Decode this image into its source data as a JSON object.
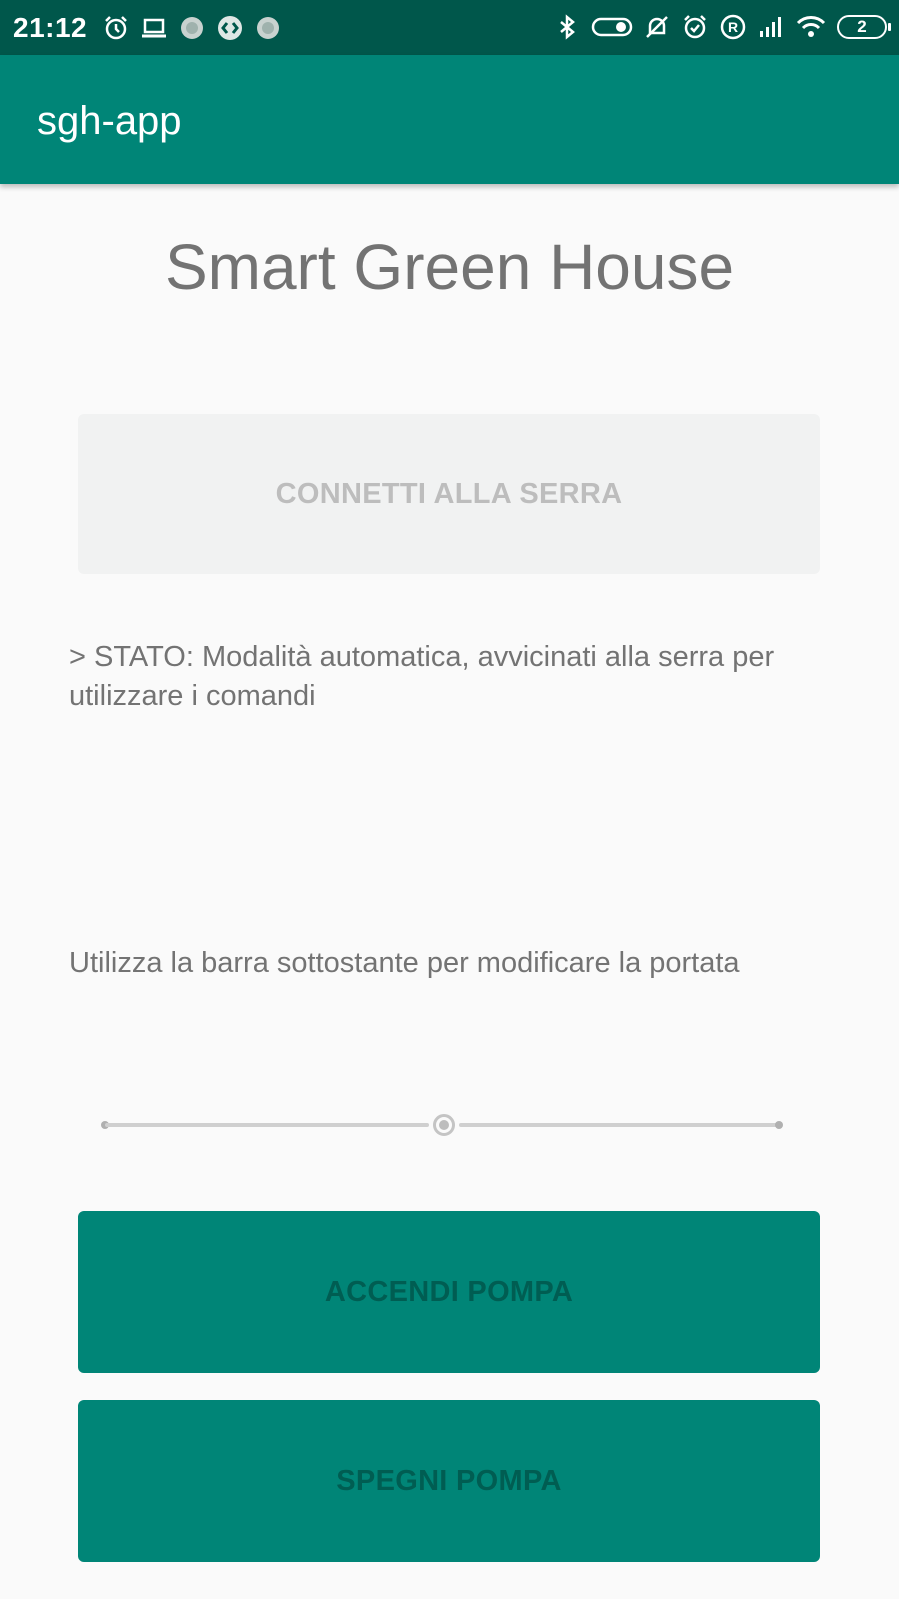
{
  "status_bar": {
    "time": "21:12",
    "battery_level": "2",
    "left_icons": [
      "alarm-icon",
      "laptop-icon",
      "notification-dot-icon",
      "shazam-icon",
      "notification-dot-icon"
    ],
    "right_icons": [
      "bluetooth-icon",
      "toggle-icon",
      "silent-bell-icon",
      "alarm-icon",
      "roaming-r-icon",
      "signal-icon",
      "wifi-icon",
      "battery-icon"
    ]
  },
  "app_bar": {
    "title": "sgh-app",
    "color": "#008577"
  },
  "main": {
    "title": "Smart Green House",
    "connect_button": "CONNETTI ALLA SERRA",
    "status_text": "> STATO: Modalità automatica, avvicinati alla serra per utilizzare i comandi",
    "hint_text": "Utilizza la barra sottostante per modificare la portata",
    "slider": {
      "value_fraction": 0.5,
      "state": "disabled"
    },
    "pump_on_button": "ACCENDI POMPA",
    "pump_off_button": "SPEGNI POMPA"
  },
  "colors": {
    "status_bar": "#00574b",
    "primary": "#008577",
    "background": "#fafafa"
  }
}
